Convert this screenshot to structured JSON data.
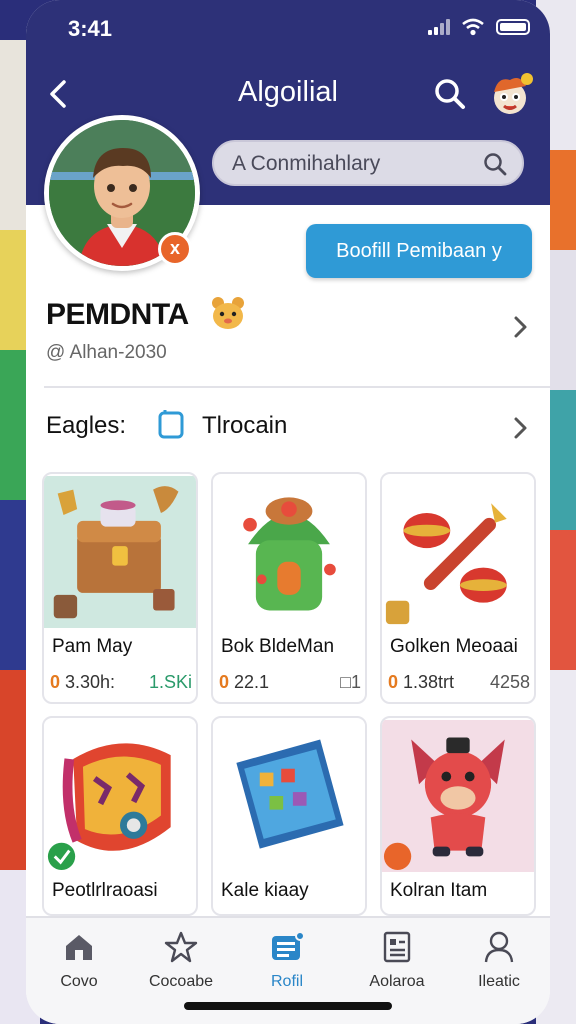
{
  "status_bar": {
    "time": "3:41"
  },
  "header": {
    "title": "Algoilial"
  },
  "search": {
    "placeholder": "A Conmihahlary"
  },
  "cta_button": {
    "label": "Boofill Pemibaan  y"
  },
  "profile": {
    "name": "PEMDNTA",
    "subtitle": "@ Alhan-2030",
    "badge": "x"
  },
  "section": {
    "label": "Eagles:",
    "tab": "Tlrocain"
  },
  "items": [
    {
      "title": "Pam May",
      "price": "3.30h:",
      "stat": "1.SKi",
      "stat_color": "green"
    },
    {
      "title": "Bok BldeMan",
      "price": "22.1",
      "stat": "□1",
      "stat_color": "gray"
    },
    {
      "title": "Golken Meoaai",
      "price": "1.38trt",
      "stat": "4258",
      "stat_color": "gray"
    },
    {
      "title": "Peotlrlraoasi",
      "price": "",
      "stat": "",
      "stat_color": "gray"
    },
    {
      "title": "Kale kiaay",
      "price": "",
      "stat": "",
      "stat_color": "gray"
    },
    {
      "title": "Kolran Itam",
      "price": "",
      "stat": "",
      "stat_color": "gray"
    }
  ],
  "tabbar": {
    "items": [
      {
        "label": "Covo",
        "icon": "home-icon"
      },
      {
        "label": "Cocoabe",
        "icon": "star-icon"
      },
      {
        "label": "Rofil",
        "icon": "profile-card-icon",
        "active": true
      },
      {
        "label": "Aolaroa",
        "icon": "document-icon"
      },
      {
        "label": "Ileatic",
        "icon": "user-icon"
      }
    ]
  },
  "colors": {
    "header_bg": "#2d3178",
    "accent": "#2f9ad6",
    "price_dot": "#e57a1f",
    "stat_green": "#2a9a6a"
  }
}
